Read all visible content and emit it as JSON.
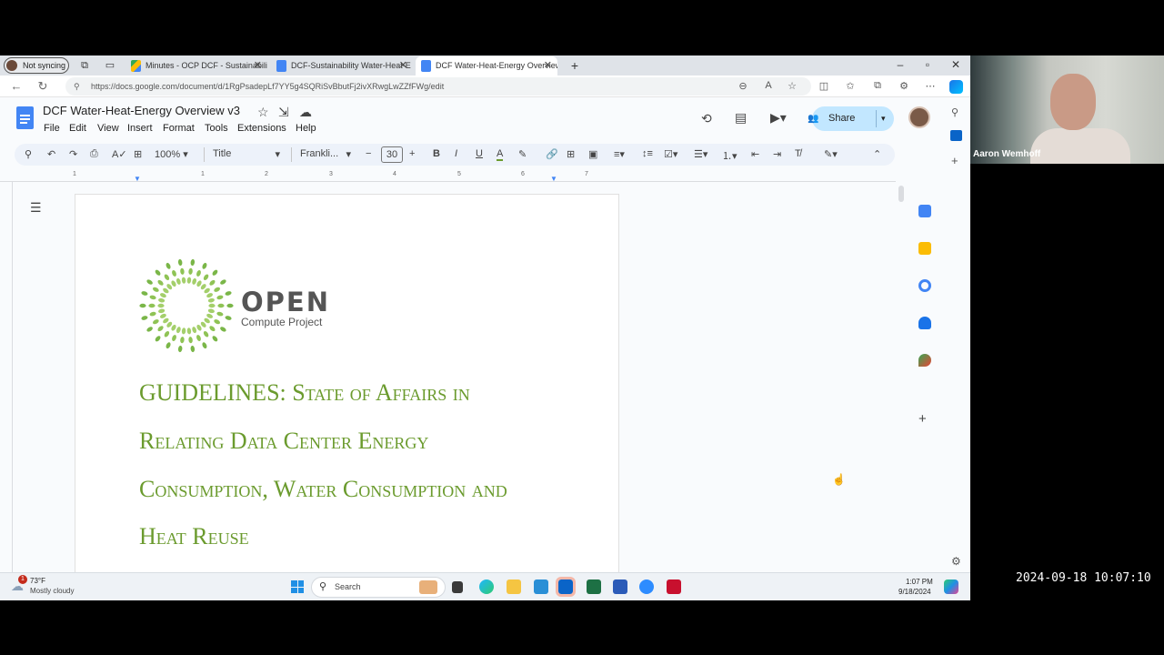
{
  "browser": {
    "profile": "Not syncing",
    "tabs": [
      {
        "title": "Minutes - OCP DCF - Sustainabili",
        "icon": "google-drive-icon"
      },
      {
        "title": "DCF-Sustainability Water-Heat-E",
        "icon": "google-docs-icon"
      },
      {
        "title": "DCF Water-Heat-Energy Overview",
        "icon": "google-docs-icon"
      }
    ],
    "url": "https://docs.google.com/document/d/1RgPsadepLf7YY5g4SQRiSvBbutFj2ivXRwgLwZZfFWg/edit"
  },
  "doc": {
    "title": "DCF Water-Heat-Energy Overview v3",
    "menus": [
      "File",
      "Edit",
      "View",
      "Insert",
      "Format",
      "Tools",
      "Extensions",
      "Help"
    ],
    "share_label": "Share",
    "toolbar": {
      "zoom": "100%",
      "style": "Title",
      "font": "Frankli...",
      "font_size": "30"
    },
    "ruler_numbers": [
      "1",
      "1",
      "2",
      "3",
      "4",
      "5",
      "6",
      "7"
    ],
    "logo": {
      "word": "OPEN",
      "sub": "Compute Project"
    },
    "heading_lines": [
      "GUIDELINES:  State of Affairs in",
      "Relating Data Center Energy",
      "Consumption, Water Consumption and",
      "Heat Reuse"
    ]
  },
  "taskbar": {
    "weather_temp": "73°F",
    "weather_desc": "Mostly cloudy",
    "search_label": "Search",
    "time": "1:07 PM",
    "date": "9/18/2024"
  },
  "webcam": {
    "name": "Aaron Wemhoff"
  },
  "recording_timestamp": "2024-09-18 10:07:10",
  "colors": {
    "heading": "#6b9b2e",
    "docs_blue": "#4285f4",
    "share_bg": "#c2e7ff"
  }
}
